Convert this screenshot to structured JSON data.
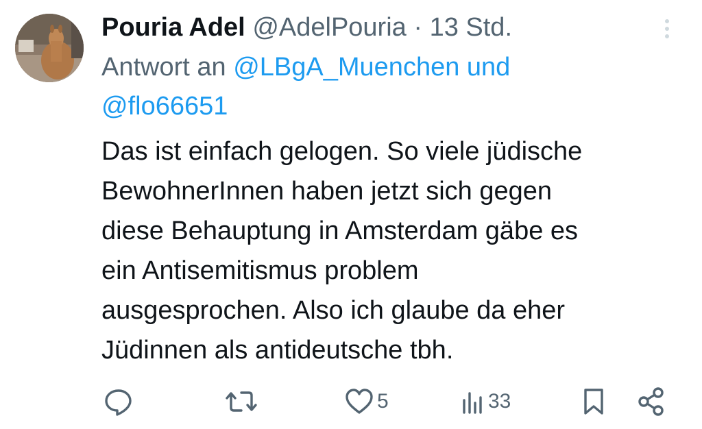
{
  "author": {
    "display_name": "Pouria Adel",
    "handle": "@AdelPouria",
    "separator": "·",
    "time": "13 Std."
  },
  "reply": {
    "prefix": "Antwort an",
    "mention_1": "@LBgA_Muenchen und",
    "mention_2": "@flo66651"
  },
  "body": {
    "lines": [
      "Das ist einfach gelogen. So viele jüdische",
      "BewohnerInnen haben jetzt sich gegen",
      "diese Behauptung in Amsterdam gäbe es",
      "ein Antisemitismus problem",
      "ausgesprochen. Also ich glaube da eher",
      "Jüdinnen als antideutsche tbh."
    ]
  },
  "actions": {
    "reply_count": "",
    "retweet_count": "",
    "like_count": "5",
    "views_count": "33"
  },
  "icons": {
    "reply": "comment-bubble-icon",
    "retweet": "retweet-icon",
    "like": "heart-icon",
    "views": "bar-chart-icon",
    "bookmark": "bookmark-icon",
    "share": "share-icon",
    "more": "more-vertical-icon"
  },
  "colors": {
    "text": "#0f1419",
    "secondary": "#536471",
    "accent": "#1d9bf0",
    "divider_dots": "#cfd9de"
  }
}
